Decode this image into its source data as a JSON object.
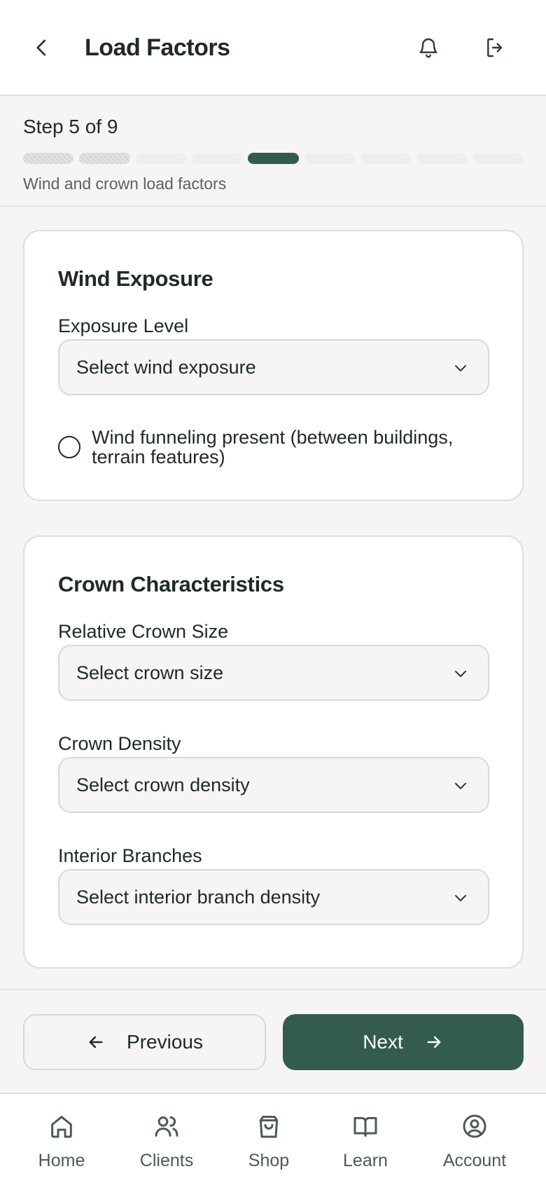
{
  "header": {
    "title": "Load Factors",
    "back_icon": "chevron-left-icon",
    "bell_icon": "bell-icon",
    "logout_icon": "logout-icon"
  },
  "progress": {
    "step_text": "Step 5 of 9",
    "current_step": 5,
    "total_steps": 9,
    "subtitle": "Wind and crown load factors"
  },
  "wind": {
    "title": "Wind Exposure",
    "exposure_label": "Exposure Level",
    "exposure_placeholder": "Select wind exposure",
    "funneling_label": "Wind funneling present (between buildings, terrain features)",
    "funneling_checked": false
  },
  "crown": {
    "title": "Crown Characteristics",
    "size_label": "Relative Crown Size",
    "size_placeholder": "Select crown size",
    "density_label": "Crown Density",
    "density_placeholder": "Select crown density",
    "interior_label": "Interior Branches",
    "interior_placeholder": "Select interior branch density"
  },
  "actions": {
    "previous_label": "Previous",
    "next_label": "Next"
  },
  "tabbar": {
    "items": [
      {
        "label": "Home",
        "icon": "home-icon"
      },
      {
        "label": "Clients",
        "icon": "users-icon"
      },
      {
        "label": "Shop",
        "icon": "shopping-bag-icon"
      },
      {
        "label": "Learn",
        "icon": "book-open-icon"
      },
      {
        "label": "Account",
        "icon": "user-circle-icon"
      }
    ]
  },
  "colors": {
    "accent": "#335c4d",
    "background": "#f6f5f3",
    "text": "#1f2a24"
  }
}
